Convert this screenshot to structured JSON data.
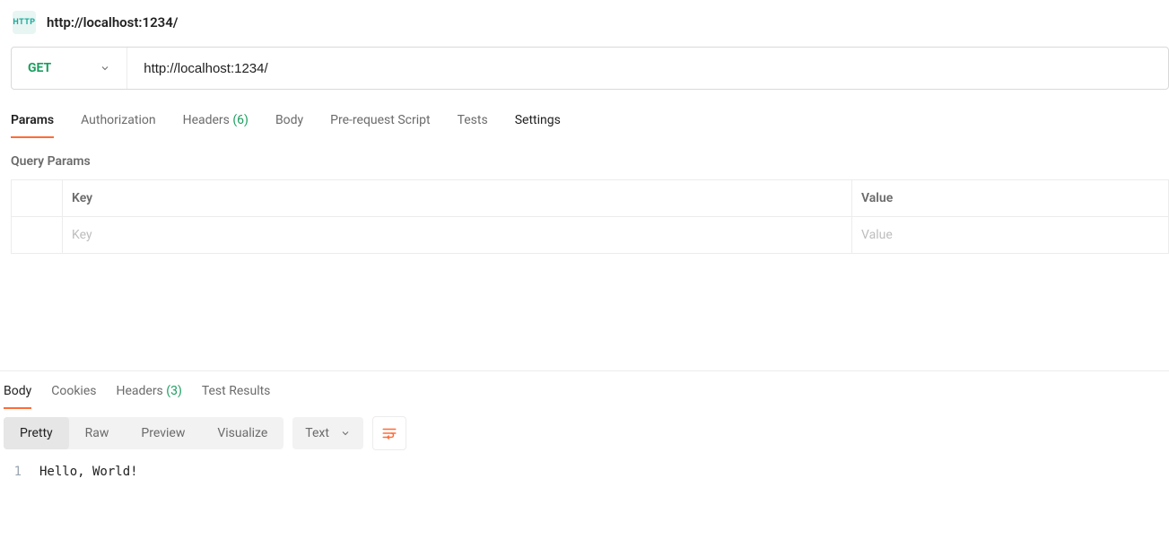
{
  "header": {
    "icon_label": "HTTP",
    "title": "http://localhost:1234/"
  },
  "request": {
    "method": "GET",
    "url": "http://localhost:1234/",
    "tabs": {
      "params": "Params",
      "authorization": "Authorization",
      "headers_label": "Headers",
      "headers_count": "(6)",
      "body": "Body",
      "prerequest": "Pre-request Script",
      "tests": "Tests",
      "settings": "Settings"
    },
    "query_params": {
      "title": "Query Params",
      "key_header": "Key",
      "value_header": "Value",
      "key_placeholder": "Key",
      "value_placeholder": "Value"
    }
  },
  "response": {
    "tabs": {
      "body": "Body",
      "cookies": "Cookies",
      "headers_label": "Headers",
      "headers_count": "(3)",
      "test_results": "Test Results"
    },
    "view_modes": {
      "pretty": "Pretty",
      "raw": "Raw",
      "preview": "Preview",
      "visualize": "Visualize"
    },
    "content_type": "Text",
    "body_lines": [
      {
        "n": "1",
        "text": "Hello, World!"
      }
    ]
  }
}
